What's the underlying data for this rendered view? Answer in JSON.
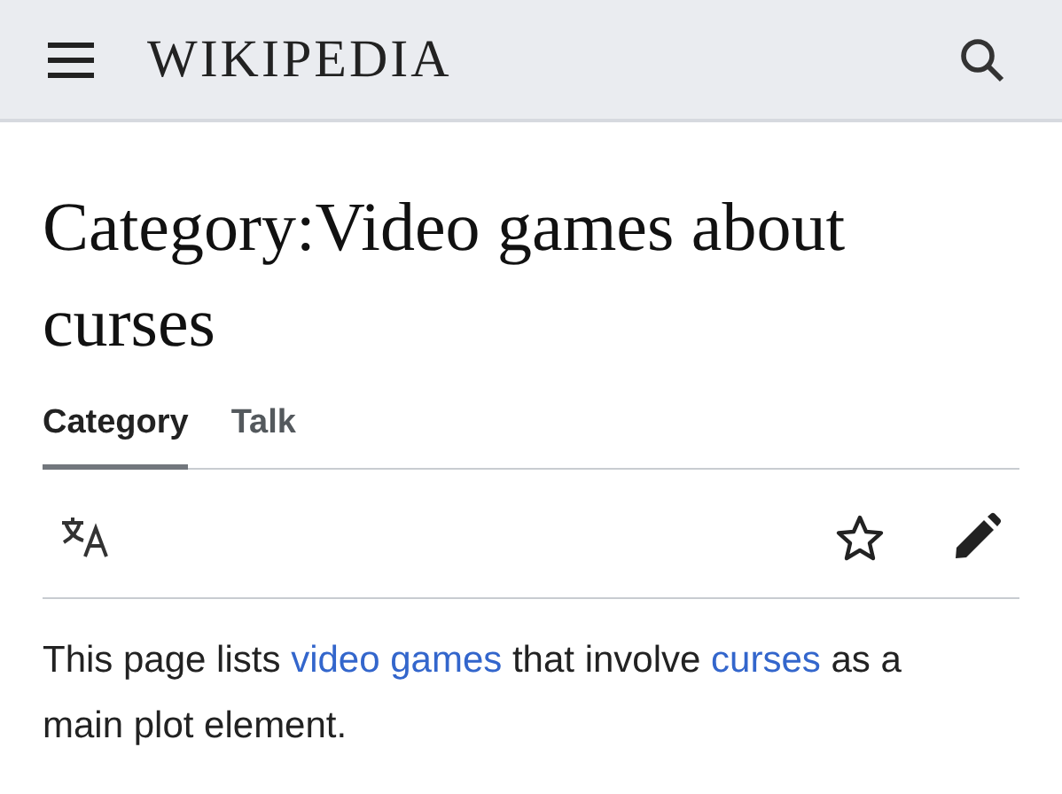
{
  "header": {
    "logo": "WIKIPEDIA"
  },
  "title": "Category:Video games about curses",
  "tabs": [
    {
      "label": "Category",
      "selected": true
    },
    {
      "label": "Talk",
      "selected": false
    }
  ],
  "intro": [
    {
      "kind": "text",
      "text": "This page lists "
    },
    {
      "kind": "link",
      "text": "video games"
    },
    {
      "kind": "text",
      "text": " that involve "
    },
    {
      "kind": "link",
      "text": "curses"
    },
    {
      "kind": "text",
      "text": " as a main plot element."
    }
  ]
}
